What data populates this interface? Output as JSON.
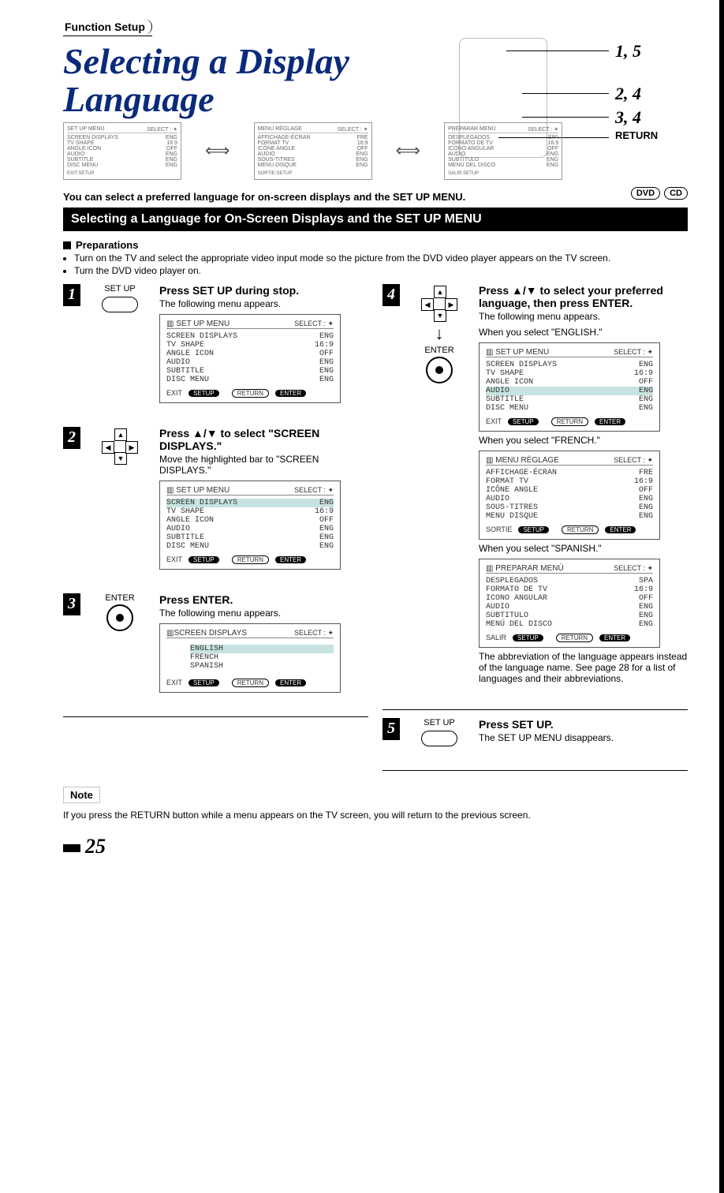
{
  "header": {
    "function_setup": "Function Setup",
    "title_line1": "Selecting a Display",
    "title_line2": "Language"
  },
  "callouts": {
    "c1": "1, 5",
    "c2": "2, 4",
    "c3": "3, 4",
    "c4": "RETURN"
  },
  "mini_screens": {
    "eng": {
      "title": "SET UP MENU",
      "sel": "SELECT : ✦",
      "rows": [
        [
          "SCREEN DISPLAYS",
          "ENG"
        ],
        [
          "TV SHAPE",
          "16:9"
        ],
        [
          "ANGLE ICON",
          "OFF"
        ],
        [
          "AUDIO",
          "ENG"
        ],
        [
          "SUBTITLE",
          "ENG"
        ],
        [
          "DISC MENU",
          "ENG"
        ]
      ],
      "foot": "EXIT:SETUP"
    },
    "fre": {
      "title": "MENU RÉGLAGE",
      "sel": "SELECT : ✦",
      "rows": [
        [
          "AFFICHAGE-ÉCRAN",
          "FRE"
        ],
        [
          "FORMAT TV",
          "16:9"
        ],
        [
          "ICÔNE ANGLE",
          "OFF"
        ],
        [
          "AUDIO",
          "ENG"
        ],
        [
          "SOUS-TITRES",
          "ENG"
        ],
        [
          "MENU DISQUE",
          "ENG"
        ]
      ],
      "foot": "SORTIE:SETUP"
    },
    "spa": {
      "title": "PREPARAR MENÚ",
      "sel": "SELECT : ✦",
      "rows": [
        [
          "DESPLEGADOS",
          "SPA"
        ],
        [
          "FORMATO DE TV",
          "16:9"
        ],
        [
          "ICONO ANGULAR",
          "OFF"
        ],
        [
          "AUDIO",
          "ENG"
        ],
        [
          "SUBTITULO",
          "ENG"
        ],
        [
          "MENÚ DEL DISCO",
          "ENG"
        ]
      ],
      "foot": "SALIR:SETUP"
    }
  },
  "lead": "You can select a preferred language for on-screen displays and the SET UP MENU.",
  "ribbon": "Selecting a Language for On-Screen Displays and the SET UP MENU",
  "media": {
    "dvd": "DVD",
    "cd": "CD"
  },
  "prep": {
    "heading": "Preparations",
    "items": [
      "Turn on the TV and select the appropriate video input mode so the picture from the DVD video player appears on the TV screen.",
      "Turn the DVD video player on."
    ]
  },
  "common": {
    "select": "SELECT : ✦",
    "exit": "EXIT",
    "setup_pill": "SETUP",
    "return_pill": "RETURN",
    "enter_pill": "ENTER",
    "sortie": "SORTIE",
    "salir": "SALIR"
  },
  "steps": {
    "s1": {
      "ctrl": "SET UP",
      "hd": "Press SET UP during stop.",
      "p": "The following menu appears.",
      "osd": {
        "title": "SET UP MENU",
        "rows": [
          [
            "SCREEN DISPLAYS",
            "ENG"
          ],
          [
            "TV SHAPE",
            "16:9"
          ],
          [
            "ANGLE ICON",
            "OFF"
          ],
          [
            "AUDIO",
            "ENG"
          ],
          [
            "SUBTITLE",
            "ENG"
          ],
          [
            "DISC MENU",
            "ENG"
          ]
        ]
      }
    },
    "s2": {
      "hd": "Press ▲/▼ to select \"SCREEN DISPLAYS.\"",
      "p": "Move the highlighted bar to \"SCREEN DISPLAYS.\"",
      "osd": {
        "title": "SET UP MENU",
        "rows": [
          [
            "SCREEN DISPLAYS",
            "ENG"
          ],
          [
            "TV SHAPE",
            "16:9"
          ],
          [
            "ANGLE ICON",
            "OFF"
          ],
          [
            "AUDIO",
            "ENG"
          ],
          [
            "SUBTITLE",
            "ENG"
          ],
          [
            "DISC MENU",
            "ENG"
          ]
        ]
      }
    },
    "s3": {
      "ctrl": "ENTER",
      "hd": "Press ENTER.",
      "p": "The following menu appears.",
      "osd": {
        "title": "SCREEN DISPLAYS",
        "items": [
          "ENGLISH",
          "FRENCH",
          "SPANISH"
        ]
      }
    },
    "s4": {
      "ctrl": "ENTER",
      "hd": "Press ▲/▼ to select your preferred language, then press ENTER.",
      "p": "The following menu appears.",
      "when_eng": "When you select \"ENGLISH.\"",
      "osd_eng": {
        "title": "SET UP MENU",
        "rows": [
          [
            "SCREEN DISPLAYS",
            "ENG"
          ],
          [
            "TV SHAPE",
            "16:9"
          ],
          [
            "ANGLE ICON",
            "OFF"
          ],
          [
            "AUDIO",
            "ENG"
          ],
          [
            "SUBTITLE",
            "ENG"
          ],
          [
            "DISC MENU",
            "ENG"
          ]
        ],
        "hl": 3
      },
      "when_fre": "When you select \"FRENCH.\"",
      "osd_fre": {
        "title": "MENU RÉGLAGE",
        "rows": [
          [
            "AFFICHAGE-ÉCRAN",
            "FRE"
          ],
          [
            "FORMAT TV",
            "16:9"
          ],
          [
            "ICÔNE ANGLE",
            "OFF"
          ],
          [
            "AUDIO",
            "ENG"
          ],
          [
            "SOUS-TITRES",
            "ENG"
          ],
          [
            "MENU DISQUE",
            "ENG"
          ]
        ]
      },
      "when_spa": "When you select \"SPANISH.\"",
      "osd_spa": {
        "title": "PREPARAR MENÚ",
        "rows": [
          [
            "DESPLEGADOS",
            "SPA"
          ],
          [
            "FORMATO DE TV",
            "16:9"
          ],
          [
            "ICONO ANGULAR",
            "OFF"
          ],
          [
            "AUDIO",
            "ENG"
          ],
          [
            "SUBTITULO",
            "ENG"
          ],
          [
            "MENÚ DEL DISCO",
            "ENG"
          ]
        ]
      },
      "after": "The abbreviation of the language appears instead of the language name. See page 28 for a list of languages and their abbreviations."
    },
    "s5": {
      "ctrl": "SET UP",
      "hd": "Press SET UP.",
      "p": "The SET UP MENU disappears."
    }
  },
  "note": {
    "label": "Note",
    "text": "If you press the RETURN button while a menu appears on the TV screen, you will return to the previous screen."
  },
  "page_number": "25"
}
